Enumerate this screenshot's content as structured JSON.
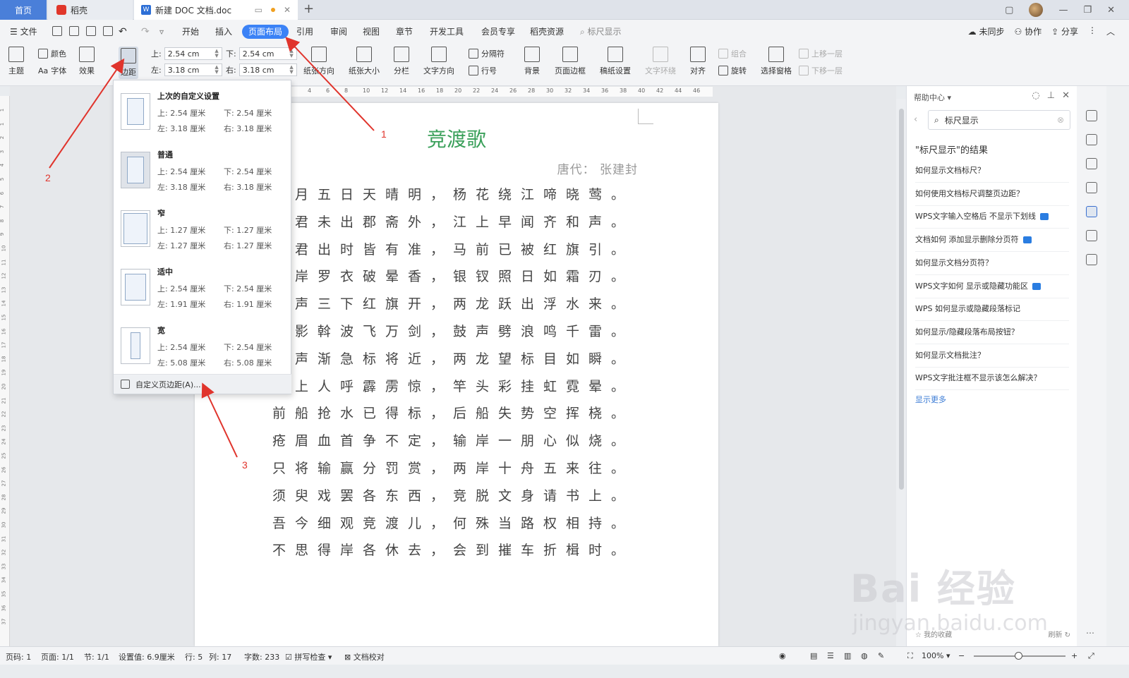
{
  "tabs": {
    "home": "首页",
    "daoke": "稻壳",
    "doc": "新建 DOC 文档.doc"
  },
  "menu": {
    "file": "文件",
    "items": [
      "开始",
      "插入",
      "页面布局",
      "引用",
      "审阅",
      "视图",
      "章节",
      "开发工具",
      "会员专享",
      "稻壳资源"
    ],
    "search": "标尺显示",
    "right": [
      "未同步",
      "协作",
      "分享"
    ]
  },
  "ribbon": {
    "theme": "主题",
    "color": "颜色",
    "font": "字体",
    "effect": "效果",
    "margins": "边距",
    "top_label": "上:",
    "top_value": "2.54 cm",
    "bottom_label": "下:",
    "bottom_value": "2.54 cm",
    "left_label": "左:",
    "left_value": "3.18 cm",
    "right_label": "右:",
    "right_value": "3.18 cm",
    "orientation": "纸张方向",
    "size": "纸张大小",
    "columns": "分栏",
    "text_direction": "文字方向",
    "separator": "分隔符",
    "line_no": "行号",
    "background": "背景",
    "page_border": "页面边框",
    "grid_paper": "稿纸设置",
    "wrap": "文字环绕",
    "align": "对齐",
    "group": "组合",
    "rotate": "旋转",
    "select_pane": "选择窗格",
    "bring_forward": "上移一层",
    "send_backward": "下移一层"
  },
  "dropdown": {
    "items": [
      {
        "name": "上次的自定义设置",
        "top": "上: 2.54 厘米",
        "bottom": "下: 2.54 厘米",
        "left": "左: 3.18 厘米",
        "right": "右: 3.18 厘米"
      },
      {
        "name": "普通",
        "top": "上: 2.54 厘米",
        "bottom": "下: 2.54 厘米",
        "left": "左: 3.18 厘米",
        "right": "右: 3.18 厘米"
      },
      {
        "name": "窄",
        "top": "上: 1.27 厘米",
        "bottom": "下: 1.27 厘米",
        "left": "左: 1.27 厘米",
        "right": "右: 1.27 厘米"
      },
      {
        "name": "适中",
        "top": "上: 2.54 厘米",
        "bottom": "下: 2.54 厘米",
        "left": "左: 1.91 厘米",
        "right": "右: 1.91 厘米"
      },
      {
        "name": "宽",
        "top": "上: 2.54 厘米",
        "bottom": "下: 2.54 厘米",
        "left": "左: 5.08 厘米",
        "right": "右: 5.08 厘米"
      }
    ],
    "custom": "自定义页边距(A)..."
  },
  "doc": {
    "title": "竞渡歌",
    "author": "唐代： 张建封",
    "lines": [
      "五月五日天晴明，杨花绕江啼晓莺。",
      "使君未出郡斋外，江上早闻齐和声。",
      "使君出时皆有准，马前已被红旗引。",
      "两岸罗衣破晕香，银钗照日如霜刃。",
      "鼓声三下红旗开，两龙跃出浮水来。",
      "棹影斡波飞万剑，鼓声劈浪鸣千雷。",
      "鼓声渐急标将近，两龙望标目如瞬。",
      "坡上人呼霹雳惊，竿头彩挂虹霓晕。",
      "前船抢水已得标，后船失势空挥桡。",
      "疮眉血首争不定，输岸一朋心似烧。",
      "只将输赢分罚赏，两岸十舟五来往。",
      "须臾戏罢各东西，竞脱文身请书上。",
      "吾今细观竞渡儿，何殊当路权相持。",
      "不思得岸各休去，会到摧车折楫时。"
    ]
  },
  "hruler": [
    "4",
    "6",
    "8",
    "10",
    "12",
    "14",
    "16",
    "18",
    "20",
    "22",
    "24",
    "26",
    "28",
    "30",
    "32",
    "34",
    "36",
    "38",
    "40",
    "42",
    "44",
    "46"
  ],
  "vruler": [
    "1",
    "1",
    "2",
    "3",
    "4",
    "5",
    "6",
    "7",
    "8",
    "9",
    "10",
    "11",
    "12",
    "13",
    "14",
    "15",
    "16",
    "17",
    "18",
    "19",
    "20",
    "21",
    "22",
    "23",
    "24",
    "25",
    "26",
    "27",
    "28",
    "29",
    "30",
    "31",
    "32",
    "33",
    "34",
    "35",
    "36",
    "37"
  ],
  "help": {
    "title": "帮助中心",
    "search": "标尺显示",
    "results_title": "\"标尺显示\"的结果",
    "links": [
      "如何显示文档标尺？",
      "如何使用文档标尺调整页边距？",
      "WPS文字输入空格后 不显示下划线",
      "文档如何 添加显示删除分页符",
      "如何显示文档分页符？",
      "WPS文字如何 显示或隐藏功能区",
      "WPS 如何显示或隐藏段落标记",
      "如何显示/隐藏段落布局按钮？",
      "如何显示文档批注？",
      "WPS文字批注框不显示该怎么解决？"
    ],
    "more": "显示更多",
    "favorites": "我的收藏",
    "refresh": "刷新"
  },
  "status": {
    "page_no": "页码: 1",
    "pages": "页面: 1/1",
    "section": "节: 1/1",
    "setting": "设置值: 6.9厘米",
    "row": "行: 5",
    "col": "列: 17",
    "words": "字数: 233",
    "spell": "拼写检查",
    "proof": "文档校对",
    "zoom": "100%"
  },
  "annotations": [
    "1",
    "2",
    "3"
  ],
  "watermark": {
    "main": "Bai 经验",
    "sub": "jingyan.baidu.com"
  },
  "colors": {
    "accent": "#3b82f6",
    "title_green": "#3aa05a",
    "arrow_red": "#e0342c"
  }
}
